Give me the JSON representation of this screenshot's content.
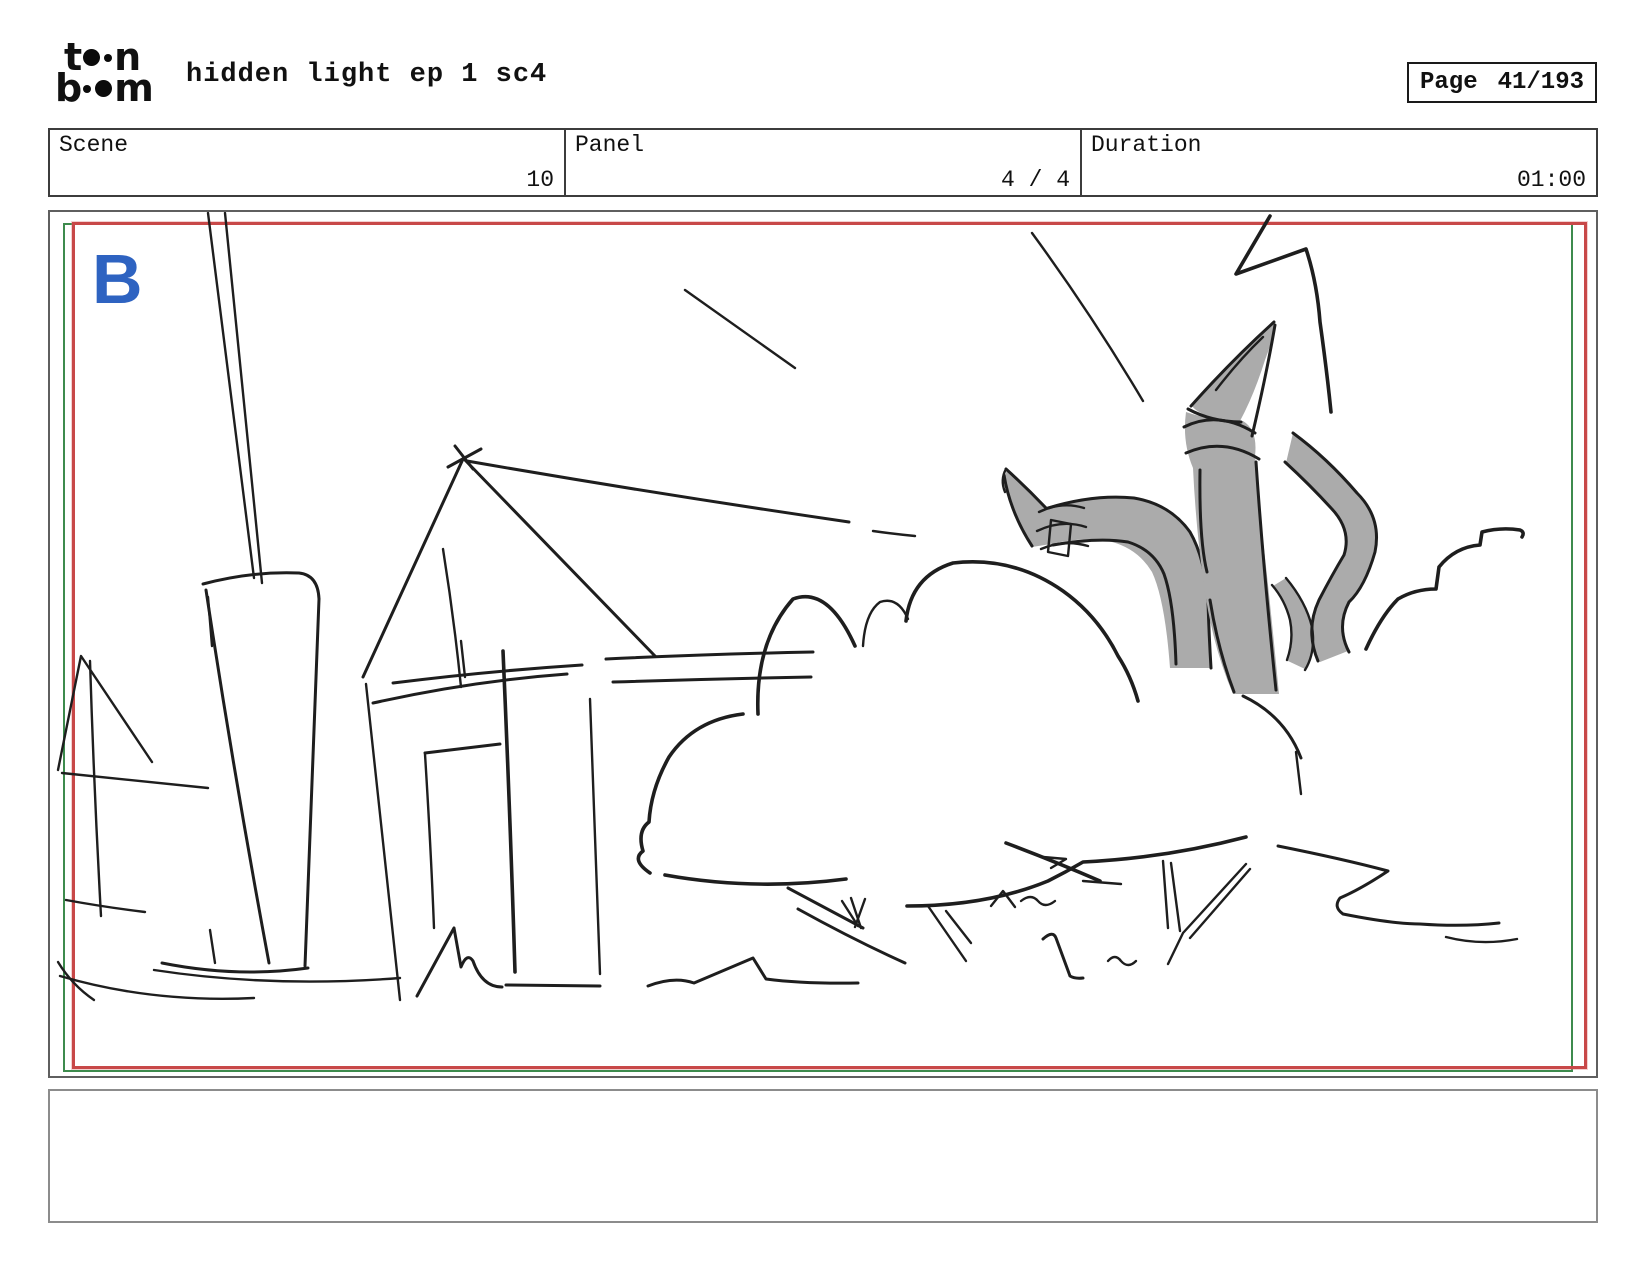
{
  "header": {
    "logo": {
      "top_left": "t",
      "top_right": "n",
      "bottom_left": "b",
      "bottom_right": "m"
    },
    "title": "hidden light ep 1 sc4",
    "page": {
      "label": "Page",
      "value": "41/193"
    }
  },
  "info": {
    "scene": {
      "label": "Scene",
      "value": "10"
    },
    "panel": {
      "label": "Panel",
      "value": "4 / 4"
    },
    "duration": {
      "label": "Duration",
      "value": "01:00"
    }
  },
  "panel": {
    "marker": "B"
  },
  "caption": {
    "text": ""
  },
  "colors": {
    "camera_frame_red": "#c84848",
    "camera_frame_green": "#3d8b4d",
    "marker_blue": "#2e63c1",
    "sketch_gray": "#ababab",
    "ink": "#1e1e1e"
  }
}
